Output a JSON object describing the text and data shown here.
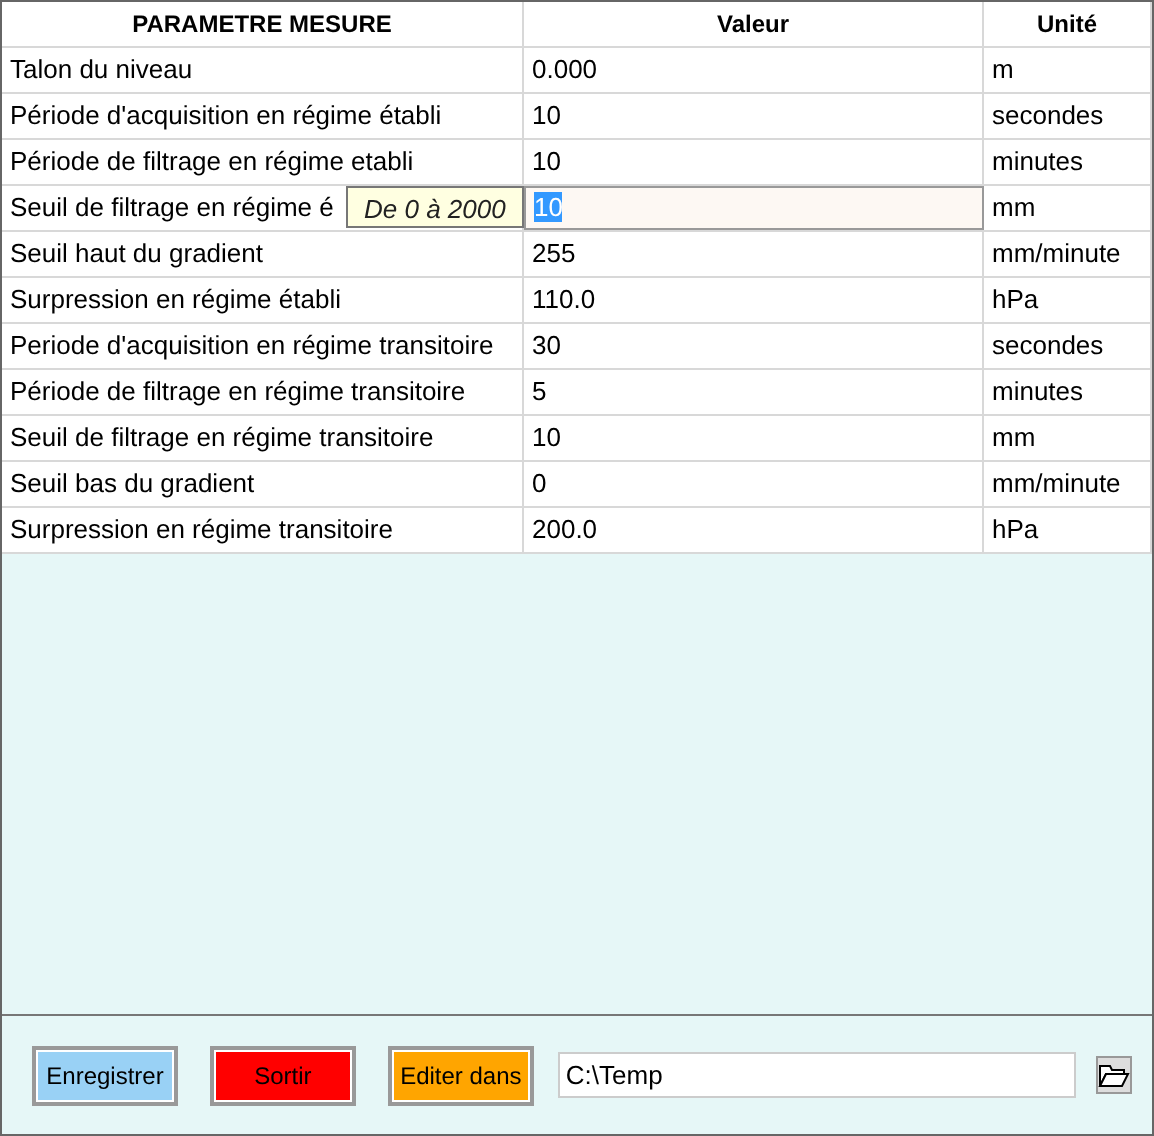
{
  "table": {
    "columns": [
      "PARAMETRE MESURE",
      "Valeur",
      "Unité"
    ],
    "rows": [
      {
        "parameter": "Talon du niveau",
        "value": "0.000",
        "unit": "m",
        "editing": false
      },
      {
        "parameter": "Période d'acquisition en régime établi",
        "value": "10",
        "unit": "secondes",
        "editing": false
      },
      {
        "parameter": "Période de filtrage en régime etabli",
        "value": "10",
        "unit": "minutes",
        "editing": false
      },
      {
        "parameter": "Seuil de filtrage en régime é",
        "value": "10",
        "unit": "mm",
        "editing": true,
        "tooltip": "De 0 à 2000"
      },
      {
        "parameter": "Seuil haut du gradient",
        "value": "255",
        "unit": "mm/minute",
        "editing": false
      },
      {
        "parameter": "Surpression en régime établi",
        "value": "110.0",
        "unit": "hPa",
        "editing": false
      },
      {
        "parameter": "Periode d'acquisition en régime transitoire",
        "value": "30",
        "unit": "secondes",
        "editing": false
      },
      {
        "parameter": "Période de filtrage en régime transitoire",
        "value": "5",
        "unit": "minutes",
        "editing": false
      },
      {
        "parameter": "Seuil de filtrage en régime transitoire",
        "value": "10",
        "unit": "mm",
        "editing": false
      },
      {
        "parameter": "Seuil bas du gradient",
        "value": "0",
        "unit": "mm/minute",
        "editing": false
      },
      {
        "parameter": "Surpression en régime transitoire",
        "value": "200.0",
        "unit": "hPa",
        "editing": false
      }
    ]
  },
  "footer": {
    "buttons": [
      {
        "label": "Enregistrer",
        "color": "#99d1f5"
      },
      {
        "label": "Sortir",
        "color": "#ff0000"
      },
      {
        "label": "Editer dans",
        "color": "#ffa500"
      }
    ],
    "path": "C:\\Temp"
  }
}
